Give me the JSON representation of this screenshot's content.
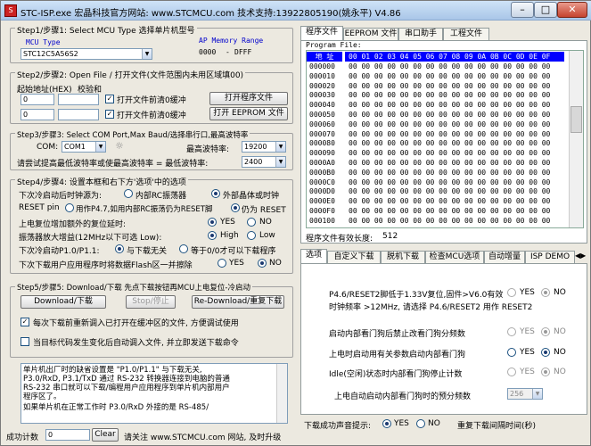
{
  "window": {
    "title": "STC-ISP.exe   宏晶科技官方网站: www.STCMCU.com  技术支持:13922805190(姚永平)  V4.86",
    "min": "–",
    "max": "□",
    "close": "✕"
  },
  "step1": {
    "legend": "Step1/步骤1: Select MCU Type  选择单片机型号",
    "mcu_type_label": "MCU Type",
    "ap_label": "AP Memory Range",
    "mcu_value": "STC12C5A56S2",
    "ap_from": "0000",
    "ap_dash": "-",
    "ap_to": "DFFF"
  },
  "step2": {
    "legend": "Step2/步骤2: Open File / 打开文件(文件范围内未用区域填00)",
    "start_addr_label": "起始地址(HEX)",
    "checksum_label": "校验和",
    "addr1": "0",
    "addr2": "0",
    "clear1_label": "打开文件前清0缓冲",
    "clear2_label": "打开文件前清0缓冲",
    "open_prog_btn": "打开程序文件",
    "open_eeprom_btn": "打开 EEPROM 文件"
  },
  "step3": {
    "legend": "Step3/步骤3: Select COM Port,Max Baud/选择串行口,最高波特率",
    "com_label": "COM:",
    "com_value": "COM1",
    "max_baud_label": "最高波特率:",
    "max_baud_value": "19200",
    "hint": "请尝试提高最低波特率或使最高波特率 = 最低波特率:",
    "min_baud_value": "2400"
  },
  "step4": {
    "legend": "Step4/步骤4: 设置本框和右下方'选项'中的选项",
    "osc_label": "下次冷启动后时钟源为:",
    "osc_opt1": "内部RC振荡器",
    "osc_opt2": "外部晶体或时钟",
    "reset_label": "RESET pin",
    "reset_opt1": "用作P4.7,如用内部RC振荡仍为RESET脚",
    "reset_opt2": "仍为 RESET",
    "delay_label": "上电复位增加额外的复位延时:",
    "yes": "YES",
    "no": "NO",
    "gain_label": "振荡器放大增益(12MHz以下可选 Low):",
    "high": "High",
    "low": "Low",
    "p10_label": "下次冷启动P1.0/P1.1:",
    "p10_opt1": "与下载无关",
    "p10_opt2": "等于0/0才可以下载程序",
    "erase_label": "下次下载用户应用程序时将数据Flash区一并擦除",
    "erase_yes": "YES",
    "erase_no": "NO"
  },
  "step5": {
    "legend": "Step5/步骤5: Download/下载   先点下载按钮再MCU上电复位-冷启动",
    "download_btn": "Download/下载",
    "stop_btn": "Stop/停止",
    "redownload_btn": "Re-Download/重复下载",
    "cb1": "每次下载前重新调入已打开在缓冲区的文件, 方便调试使用",
    "cb2": "当目标代码发生变化后自动调入文件, 并立即发送下载命令"
  },
  "console": {
    "lines": [
      "  单片机出厂时的缺省设置是 \"P1.0/P1.1\" 与下载无关,",
      "P3.0/RxD, P3.1/TxD 通过 RS-232 转换器连接到电脑的普通",
      "RS-232 串口就可以下载/编程用户应用程序到单片机内部用户",
      "程序区了。",
      "  如果单片机在正常工作时 P3.0/RxD 外接的是 RS-485/"
    ]
  },
  "bottom": {
    "count_label": "成功计数",
    "count_value": "0",
    "clear_btn": "Clear",
    "visit_text": "请关注 www.STCMCU.com 网站, 及时升级"
  },
  "right": {
    "tabs": [
      "程序文件",
      "EEPROM 文件",
      "串口助手",
      "工程文件"
    ],
    "program_file_label": "Program File:",
    "hex_addr_header": "地 址",
    "hex_cols": "00 01 02 03 04 05 06 07 08 09 0A 0B 0C 0D 0E 0F",
    "hex_rows": [
      {
        "a": "000000",
        "d": "00 00 00 00 00 00 00 00 00 00 00 00 00 00 00 00"
      },
      {
        "a": "000010",
        "d": "00 00 00 00 00 00 00 00 00 00 00 00 00 00 00 00"
      },
      {
        "a": "000020",
        "d": "00 00 00 00 00 00 00 00 00 00 00 00 00 00 00 00"
      },
      {
        "a": "000030",
        "d": "00 00 00 00 00 00 00 00 00 00 00 00 00 00 00 00"
      },
      {
        "a": "000040",
        "d": "00 00 00 00 00 00 00 00 00 00 00 00 00 00 00 00"
      },
      {
        "a": "000050",
        "d": "00 00 00 00 00 00 00 00 00 00 00 00 00 00 00 00"
      },
      {
        "a": "000060",
        "d": "00 00 00 00 00 00 00 00 00 00 00 00 00 00 00 00"
      },
      {
        "a": "000070",
        "d": "00 00 00 00 00 00 00 00 00 00 00 00 00 00 00 00"
      },
      {
        "a": "000080",
        "d": "00 00 00 00 00 00 00 00 00 00 00 00 00 00 00 00"
      },
      {
        "a": "000090",
        "d": "00 00 00 00 00 00 00 00 00 00 00 00 00 00 00 00"
      },
      {
        "a": "0000A0",
        "d": "00 00 00 00 00 00 00 00 00 00 00 00 00 00 00 00"
      },
      {
        "a": "0000B0",
        "d": "00 00 00 00 00 00 00 00 00 00 00 00 00 00 00 00"
      },
      {
        "a": "0000C0",
        "d": "00 00 00 00 00 00 00 00 00 00 00 00 00 00 00 00"
      },
      {
        "a": "0000D0",
        "d": "00 00 00 00 00 00 00 00 00 00 00 00 00 00 00 00"
      },
      {
        "a": "0000E0",
        "d": "00 00 00 00 00 00 00 00 00 00 00 00 00 00 00 00"
      },
      {
        "a": "0000F0",
        "d": "00 00 00 00 00 00 00 00 00 00 00 00 00 00 00 00"
      },
      {
        "a": "000100",
        "d": "00 00 00 00 00 00 00 00 00 00 00 00 00 00 00 00"
      }
    ],
    "checksum_label": "程序文件有效长度:",
    "checksum_value": "512",
    "opt_tabs": [
      "选项",
      "自定义下载",
      "脱机下载",
      "检查MCU选项",
      "自动增量",
      "ISP DEMO"
    ],
    "opt1_label": "P4.6/RESET2脚低于1.33V复位,固件>V6.0有效",
    "opt1_line2": "时钟频率 >12MHz, 请选择 P4.6/RESET2 用作 RESET2",
    "opt2_label": "启动内部看门狗后禁止改看门狗分频数",
    "opt3_label": "上电时启动用有关参数启动内部看门狗",
    "opt4_label": "Idle(空闲)状态时内部看门狗停止计数",
    "opt5_label": "上电自动启动内部看门狗时的预分频数",
    "opt5_value": "256",
    "yes": "YES",
    "no": "NO",
    "beep_label": "下载成功声音提示:",
    "beep_yes": "YES",
    "beep_no": "NO",
    "repeat_label": "重复下载间隔时间(秒)"
  }
}
